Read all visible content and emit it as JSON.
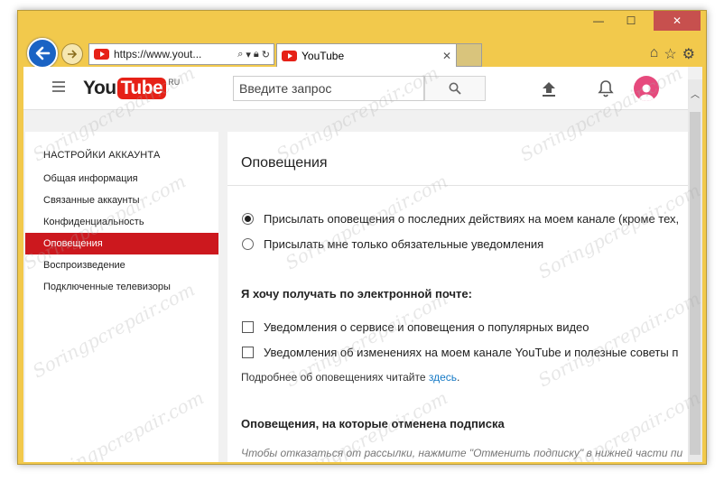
{
  "browser": {
    "address": "https://www.yout...",
    "tab_title": "YouTube",
    "window_controls": {
      "minimize": "—",
      "maximize": "☐",
      "close": "✕"
    },
    "tools": [
      "home-icon",
      "star-icon",
      "gear-icon"
    ]
  },
  "header": {
    "logo_you": "You",
    "logo_tube": "Tube",
    "logo_region": "RU",
    "search_placeholder": "Введите запрос"
  },
  "sidebar": {
    "heading": "НАСТРОЙКИ АККАУНТА",
    "items": [
      {
        "label": "Общая информация",
        "active": false
      },
      {
        "label": "Связанные аккаунты",
        "active": false
      },
      {
        "label": "Конфиденциальность",
        "active": false
      },
      {
        "label": "Оповещения",
        "active": true
      },
      {
        "label": "Воспроизведение",
        "active": false
      },
      {
        "label": "Подключенные телевизоры",
        "active": false
      }
    ]
  },
  "main": {
    "title": "Оповещения",
    "radio_options": [
      {
        "label": "Присылать оповещения о последних действиях на моем канале (кроме тех,",
        "checked": true
      },
      {
        "label": "Присылать мне только обязательные уведомления",
        "checked": false
      }
    ],
    "email_heading": "Я хочу получать по электронной почте:",
    "email_options": [
      {
        "label": "Уведомления о сервисе и оповещения о популярных видео",
        "checked": false
      },
      {
        "label": "Уведомления об изменениях на моем канале YouTube и полезные советы п",
        "checked": false
      }
    ],
    "more_text": "Подробнее об оповещениях читайте",
    "more_link": "здесь",
    "more_end": ".",
    "unsubscribed_heading": "Оповещения, на которые отменена подписка",
    "unsubscribe_hint": "Чтобы отказаться от рассылки, нажмите \"Отменить подписку\" в нижней части пи"
  },
  "watermark": "Soringpcrepair.com",
  "colors": {
    "accent": "#cc181e",
    "browser_frame": "#f2c94c",
    "link": "#167ac6"
  }
}
